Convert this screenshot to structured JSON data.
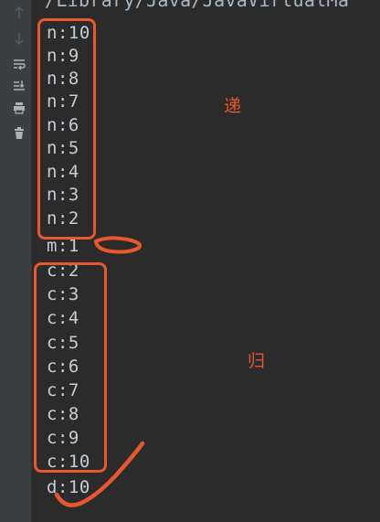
{
  "toolbar": {
    "buttons": [
      {
        "icon": "arrow-up-icon"
      },
      {
        "icon": "arrow-down-icon"
      },
      {
        "icon": "soft-wrap-icon"
      },
      {
        "icon": "scroll-to-end-icon"
      },
      {
        "icon": "print-icon"
      },
      {
        "icon": "trash-icon"
      }
    ]
  },
  "console": {
    "path": "/Library/Java/JavaVirtualMa",
    "lines": [
      "n:10",
      "n:9",
      "n:8",
      "n:7",
      "n:6",
      "n:5",
      "n:4",
      "n:3",
      "n:2",
      "m:1",
      "c:2",
      "c:3",
      "c:4",
      "c:5",
      "c:6",
      "c:7",
      "c:8",
      "c:9",
      "c:10",
      "d:10"
    ]
  },
  "annotations": {
    "recursion_label": "递",
    "return_label": "归",
    "color": "#e8572d"
  }
}
